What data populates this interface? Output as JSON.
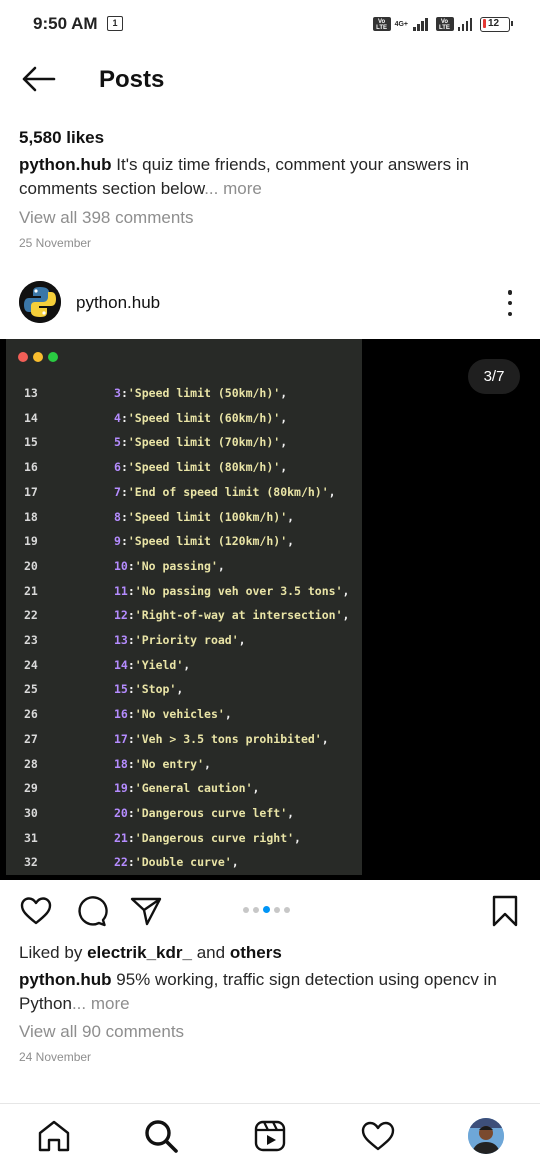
{
  "status_bar": {
    "time": "9:50 AM",
    "notification_count": "1",
    "network": "4G+",
    "volte": "Vo LTE",
    "battery": "12"
  },
  "header": {
    "title": "Posts"
  },
  "previous_post": {
    "likes": "5,580 likes",
    "username": "python.hub",
    "caption": "It's quiz time friends, comment your answers in comments section below",
    "more": "... more",
    "view_comments": "View all 398 comments",
    "date": "25 November"
  },
  "post": {
    "username": "python.hub",
    "counter": "3/7",
    "code_lines": [
      {
        "ln": "13",
        "num": "3",
        "text": "'Speed limit (50km/h)'"
      },
      {
        "ln": "14",
        "num": "4",
        "text": "'Speed limit (60km/h)'"
      },
      {
        "ln": "15",
        "num": "5",
        "text": "'Speed limit (70km/h)'"
      },
      {
        "ln": "16",
        "num": "6",
        "text": "'Speed limit (80km/h)'"
      },
      {
        "ln": "17",
        "num": "7",
        "text": "'End of speed limit (80km/h)'"
      },
      {
        "ln": "18",
        "num": "8",
        "text": "'Speed limit (100km/h)'"
      },
      {
        "ln": "19",
        "num": "9",
        "text": "'Speed limit (120km/h)'"
      },
      {
        "ln": "20",
        "num": "10",
        "text": "'No passing'"
      },
      {
        "ln": "21",
        "num": "11",
        "text": "'No passing veh over 3.5 tons'"
      },
      {
        "ln": "22",
        "num": "12",
        "text": "'Right-of-way at intersection'"
      },
      {
        "ln": "23",
        "num": "13",
        "text": "'Priority road'"
      },
      {
        "ln": "24",
        "num": "14",
        "text": "'Yield'"
      },
      {
        "ln": "25",
        "num": "15",
        "text": "'Stop'"
      },
      {
        "ln": "26",
        "num": "16",
        "text": "'No vehicles'"
      },
      {
        "ln": "27",
        "num": "17",
        "text": "'Veh > 3.5 tons prohibited'"
      },
      {
        "ln": "28",
        "num": "18",
        "text": "'No entry'"
      },
      {
        "ln": "29",
        "num": "19",
        "text": "'General caution'"
      },
      {
        "ln": "30",
        "num": "20",
        "text": "'Dangerous curve left'"
      },
      {
        "ln": "31",
        "num": "21",
        "text": "'Dangerous curve right'"
      },
      {
        "ln": "32",
        "num": "22",
        "text": "'Double curve'"
      }
    ],
    "carousel_pages": 7,
    "carousel_current": 3,
    "liked_by_prefix": "Liked by",
    "liked_by_user": "electrik_kdr_",
    "liked_by_and": "and",
    "liked_by_others": "others",
    "caption": "95% working, traffic sign detection using opencv in Python",
    "more": "... more",
    "view_comments": "View all 90 comments",
    "date": "24 November"
  },
  "colors": {
    "code_bg": "#282a27",
    "code_string": "#e9e4a6",
    "code_number": "#b58cff",
    "accent_blue": "#0095f6"
  },
  "icons": {
    "back": "arrow-left-icon",
    "more": "kebab-icon",
    "like": "heart-icon",
    "comment": "comment-icon",
    "share": "send-icon",
    "save": "bookmark-icon",
    "home": "home-icon",
    "search": "search-icon",
    "reels": "reels-icon",
    "activity": "heart-icon",
    "profile": "avatar"
  }
}
